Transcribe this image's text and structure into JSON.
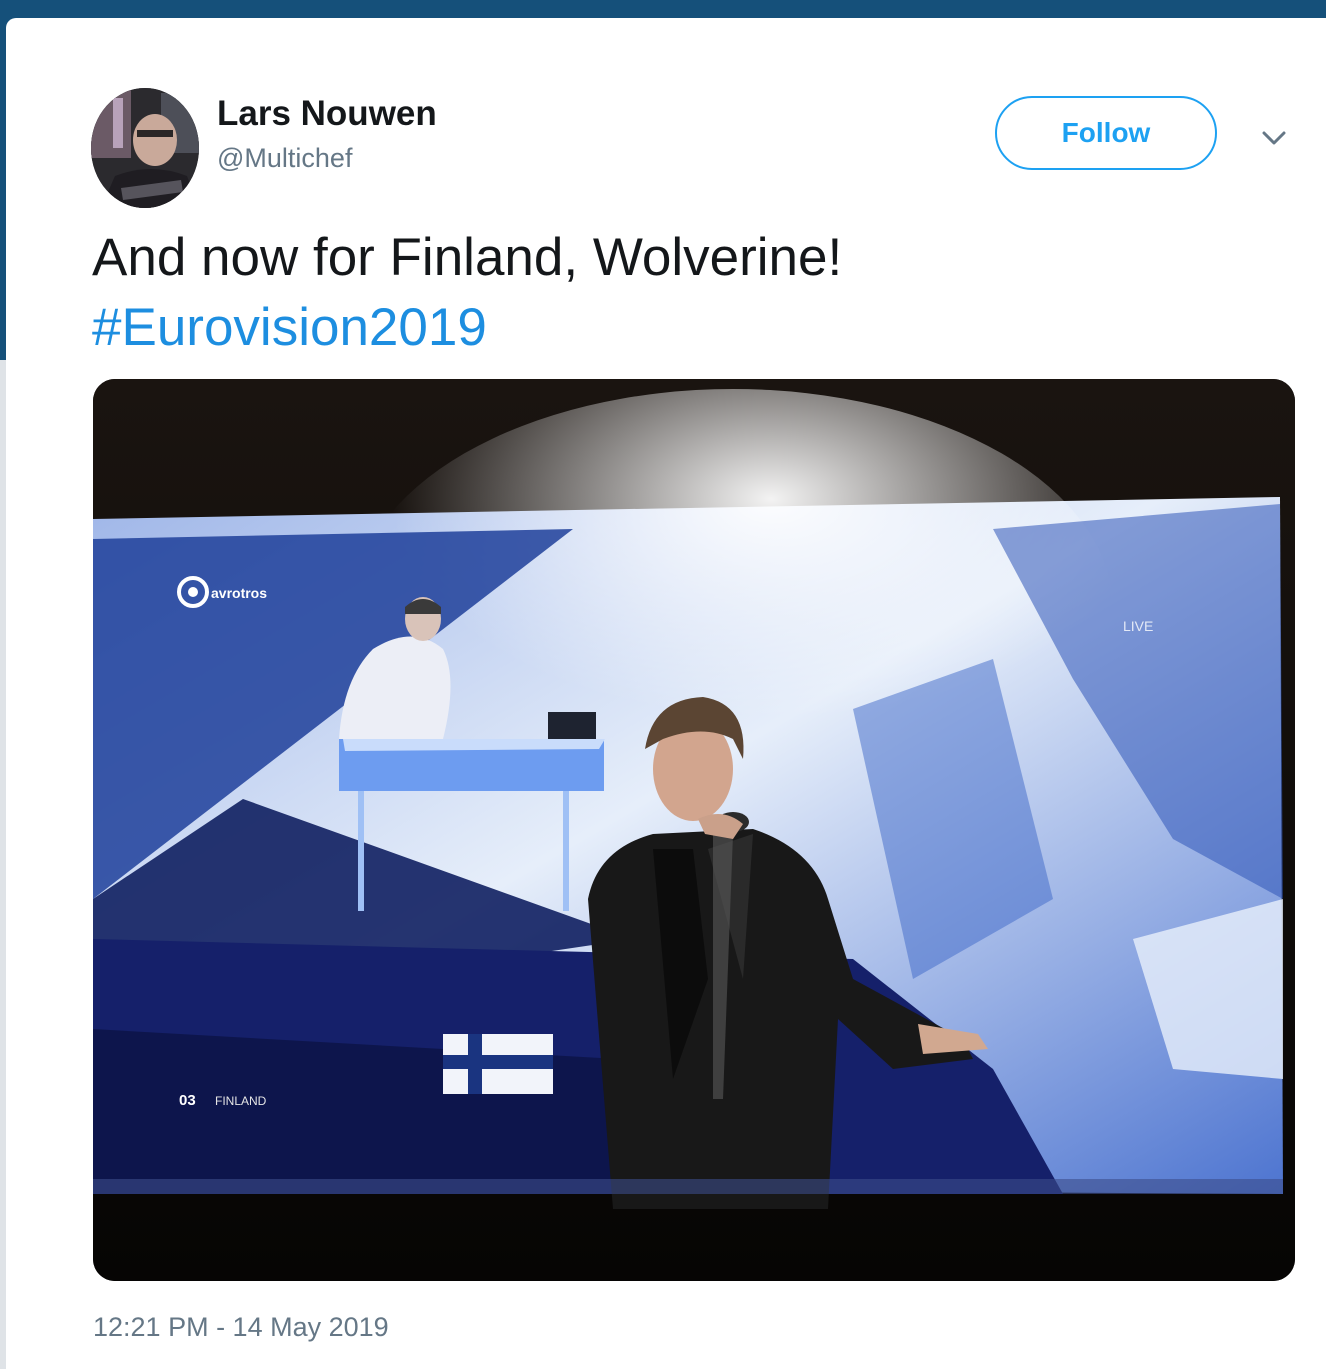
{
  "tweet": {
    "author_name": "Lars Nouwen",
    "author_handle": "@Multichef",
    "follow_label": "Follow",
    "text": "And now for Finland, Wolverine!",
    "hashtag": "#Eurovision2019",
    "timestamp": "12:21 PM - 14 May 2019"
  },
  "media": {
    "broadcaster_logo": "avrotros",
    "channel_badge": "LIVE",
    "caption_number": "03",
    "caption_country": "FINLAND"
  },
  "icons": {
    "menu": "chevron-down-icon"
  },
  "colors": {
    "accent": "#1da1f2",
    "hashtag": "#1d8ee0",
    "frame": "#15507a"
  }
}
